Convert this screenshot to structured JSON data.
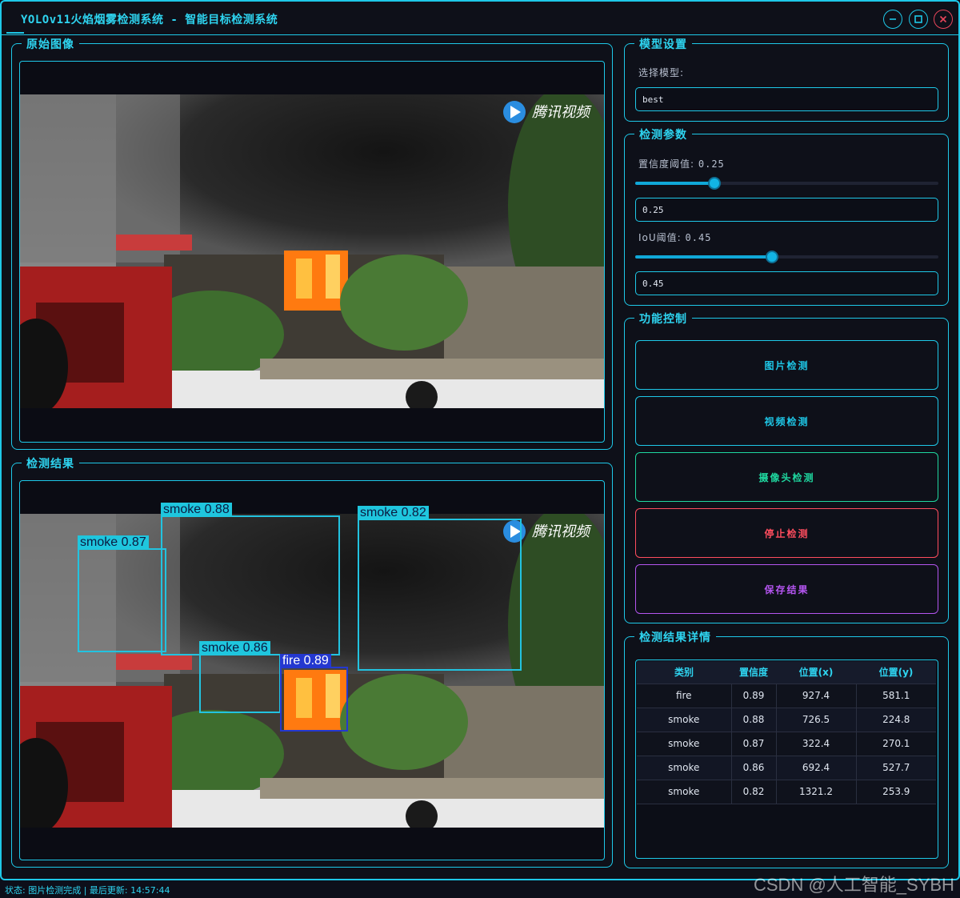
{
  "window": {
    "title": "YOLOv11火焰烟雾检测系统 - 智能目标检测系统"
  },
  "original": {
    "title": "原始图像",
    "watermark": "腾讯视频"
  },
  "result": {
    "title": "检测结果",
    "watermark": "腾讯视频",
    "detections": [
      {
        "label": "smoke 0.87",
        "class": "smoke"
      },
      {
        "label": "smoke 0.88",
        "class": "smoke"
      },
      {
        "label": "smoke 0.82",
        "class": "smoke"
      },
      {
        "label": "smoke 0.86",
        "class": "smoke"
      },
      {
        "label": "fire 0.89",
        "class": "fire"
      }
    ]
  },
  "model": {
    "title": "模型设置",
    "select_label": "选择模型:",
    "value": "best"
  },
  "params": {
    "title": "检测参数",
    "conf_label": "置信度阈值:",
    "conf_display": "0.25",
    "conf_value": "0.25",
    "conf_fraction": 0.25,
    "iou_label": "IoU阈值:",
    "iou_display": "0.45",
    "iou_value": "0.45",
    "iou_fraction": 0.45
  },
  "controls": {
    "title": "功能控制",
    "image_detect": "图片检测",
    "video_detect": "视频检测",
    "camera_detect": "摄像头检测",
    "stop_detect": "停止检测",
    "save_result": "保存结果",
    "colors": {
      "image": "#1ec8e8",
      "video": "#1ec8e8",
      "camera": "#1fd8a0",
      "stop": "#ff4d5e",
      "save": "#b455f0"
    }
  },
  "details": {
    "title": "检测结果详情",
    "headers": [
      "类别",
      "置信度",
      "位置(x)",
      "位置(y)"
    ],
    "rows": [
      [
        "fire",
        "0.89",
        "927.4",
        "581.1"
      ],
      [
        "smoke",
        "0.88",
        "726.5",
        "224.8"
      ],
      [
        "smoke",
        "0.87",
        "322.4",
        "270.1"
      ],
      [
        "smoke",
        "0.86",
        "692.4",
        "527.7"
      ],
      [
        "smoke",
        "0.82",
        "1321.2",
        "253.9"
      ]
    ]
  },
  "status": {
    "text": "状态: 图片检测完成 | 最后更新: 14:57:44"
  },
  "watermark": "CSDN @人工智能_SYBH"
}
